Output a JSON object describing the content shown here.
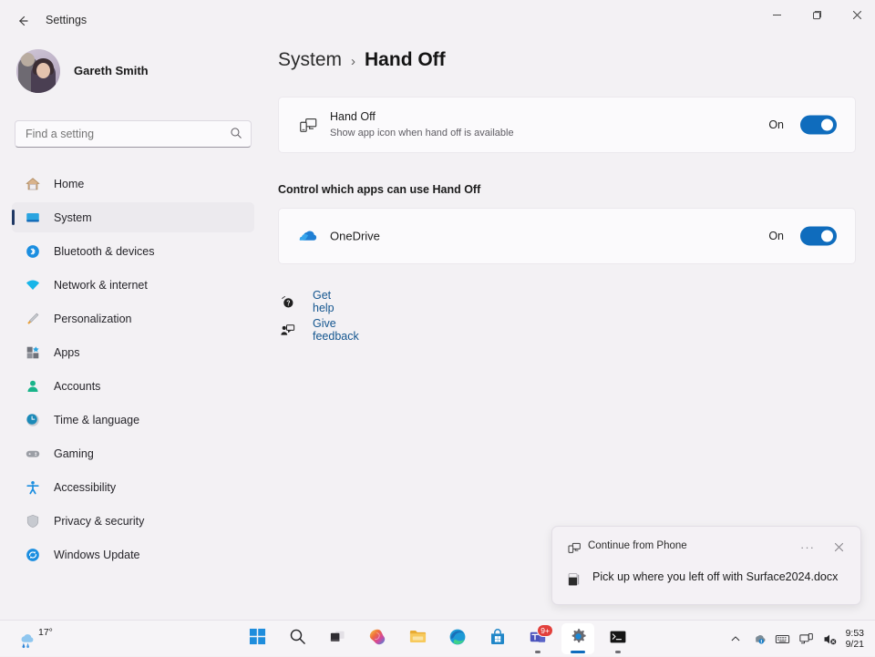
{
  "window": {
    "title": "Settings",
    "back_icon": "arrow-left-icon",
    "minimize_label": "—",
    "maximize_label": "❐",
    "close_label": "✕"
  },
  "sidebar": {
    "account": {
      "name": "Gareth Smith",
      "avatar_icon": "user-avatar"
    },
    "search": {
      "placeholder": "Find a setting",
      "value": "",
      "icon": "search-icon"
    },
    "items": [
      {
        "label": "Home",
        "icon": "home-icon",
        "selected": false
      },
      {
        "label": "System",
        "icon": "system-monitor-icon",
        "selected": true
      },
      {
        "label": "Bluetooth & devices",
        "icon": "bluetooth-icon",
        "selected": false
      },
      {
        "label": "Network & internet",
        "icon": "wifi-icon",
        "selected": false
      },
      {
        "label": "Personalization",
        "icon": "paintbrush-icon",
        "selected": false
      },
      {
        "label": "Apps",
        "icon": "apps-icon",
        "selected": false
      },
      {
        "label": "Accounts",
        "icon": "person-icon",
        "selected": false
      },
      {
        "label": "Time & language",
        "icon": "clock-icon",
        "selected": false
      },
      {
        "label": "Gaming",
        "icon": "gamepad-icon",
        "selected": false
      },
      {
        "label": "Accessibility",
        "icon": "accessibility-icon",
        "selected": false
      },
      {
        "label": "Privacy & security",
        "icon": "shield-icon",
        "selected": false
      },
      {
        "label": "Windows Update",
        "icon": "update-refresh-icon",
        "selected": false
      }
    ]
  },
  "main": {
    "breadcrumb": {
      "parent": "System",
      "separator": "›",
      "current": "Hand Off"
    },
    "handoff_card": {
      "icon": "phone-to-monitor-icon",
      "title": "Hand Off",
      "subtitle": "Show app icon when hand off is available",
      "toggle_state": "On",
      "toggle_on": true
    },
    "apps_heading": "Control which apps can use Hand Off",
    "app_rows": [
      {
        "icon": "onedrive-cloud-icon",
        "name": "OneDrive",
        "toggle_state": "On",
        "toggle_on": true
      }
    ],
    "links": [
      {
        "label": "Get help",
        "icon": "help-question-icon"
      },
      {
        "label": "Give feedback",
        "icon": "feedback-person-icon"
      }
    ]
  },
  "toast": {
    "app_icon": "phone-to-monitor-icon",
    "app_name": "Continue from Phone",
    "more_label": "···",
    "close_label": "✕",
    "doc_icon": "word-document-icon",
    "message": "Pick up where you left off with Surface2024.docx"
  },
  "taskbar": {
    "weather": {
      "temperature": "17°",
      "icon": "rain-showers-icon"
    },
    "buttons": [
      {
        "name": "start",
        "icon": "windows-start-icon",
        "state": "idle"
      },
      {
        "name": "search",
        "icon": "search-icon",
        "state": "idle"
      },
      {
        "name": "task-view",
        "icon": "task-view-icon",
        "state": "idle"
      },
      {
        "name": "copilot",
        "icon": "copilot-icon",
        "state": "idle"
      },
      {
        "name": "file-explorer",
        "icon": "folder-icon",
        "state": "idle"
      },
      {
        "name": "edge",
        "icon": "edge-browser-icon",
        "state": "idle"
      },
      {
        "name": "microsoft-store",
        "icon": "store-bag-icon",
        "state": "idle"
      },
      {
        "name": "teams",
        "icon": "teams-icon",
        "state": "running",
        "badge": "9+"
      },
      {
        "name": "settings",
        "icon": "gear-icon",
        "state": "active"
      },
      {
        "name": "terminal",
        "icon": "terminal-icon",
        "state": "running"
      }
    ],
    "tray": [
      {
        "name": "show-hidden-icons",
        "icon": "chevron-up-icon"
      },
      {
        "name": "onedrive-status",
        "icon": "onedrive-cloud-icon"
      },
      {
        "name": "input-indicator",
        "icon": "keyboard-icon"
      },
      {
        "name": "handoff-indicator",
        "icon": "phone-to-monitor-icon"
      },
      {
        "name": "volume",
        "icon": "speaker-muted-icon"
      }
    ],
    "clock": {
      "time": "9:53",
      "date": "9/21"
    }
  },
  "colors": {
    "accent": "#0f6cbd",
    "page_bg": "#f3f1f4",
    "card_bg": "#fbfafc",
    "link": "#14568f",
    "badge": "#e2403c"
  }
}
